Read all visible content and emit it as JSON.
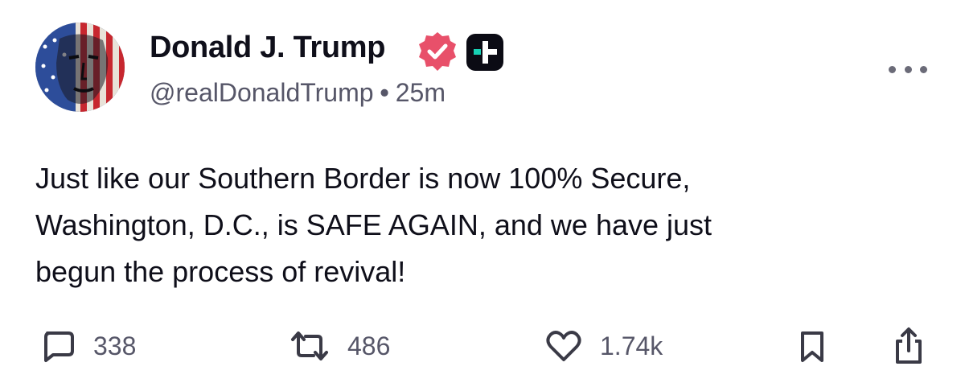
{
  "post": {
    "author_name": "Donald J. Trump",
    "handle": "@realDonaldTrump",
    "separator": "•",
    "time_ago": "25m",
    "text": "Just like our Southern Border is now 100% Secure,\nWashington, D.C., is SAFE AGAIN, and we have just\nbegun the process of revival!"
  },
  "actions": {
    "replies": "338",
    "reposts": "486",
    "likes": "1.74k"
  },
  "icons": {
    "avatar": "flag-face-avatar",
    "verified": "verified-badge-icon",
    "plus": "truth-plus-icon",
    "more": "more-dots-icon",
    "reply": "reply-bubble-icon",
    "repost": "repost-arrows-icon",
    "like": "heart-icon",
    "bookmark": "bookmark-icon",
    "share": "share-icon"
  },
  "colors": {
    "text": "#0f0f1a",
    "muted": "#565668",
    "verified_pink": "#e8506a",
    "plus_teal": "#17d1b4"
  }
}
